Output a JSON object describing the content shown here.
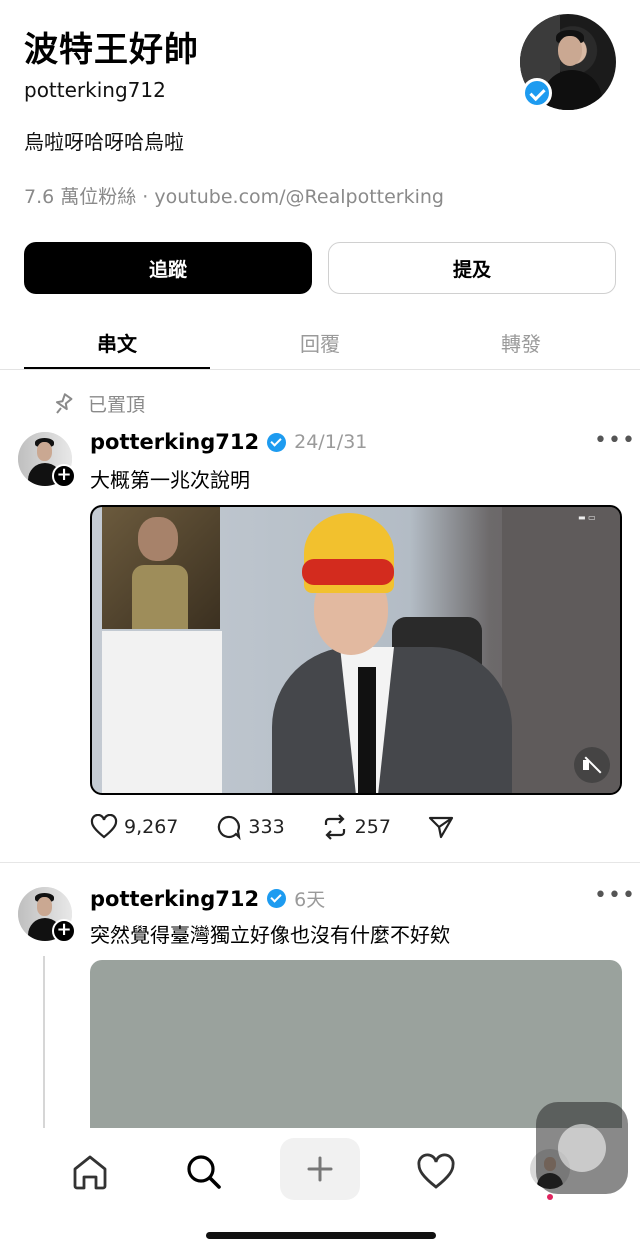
{
  "profile": {
    "display_name": "波特王好帥",
    "username": "potterking712",
    "bio": "烏啦呀哈呀哈烏啦",
    "meta": "7.6 萬位粉絲 · youtube.com/@Realpotterking",
    "verified": true
  },
  "buttons": {
    "follow_label": "追蹤",
    "mention_label": "提及"
  },
  "tabs": [
    {
      "label": "串文",
      "active": true
    },
    {
      "label": "回覆",
      "active": false
    },
    {
      "label": "轉發",
      "active": false
    }
  ],
  "pinned_label": "已置頂",
  "posts": [
    {
      "username": "potterking712",
      "time": "24/1/31",
      "text": "大概第一兆次說明",
      "likes": "9,267",
      "replies": "333",
      "reposts": "257",
      "has_video": true,
      "muted": true
    },
    {
      "username": "potterking712",
      "time": "6天",
      "text": "突然覺得臺灣獨立好像也沒有什麼不好欸"
    }
  ],
  "icons": {
    "pin": "pin-icon",
    "more": "more-dots-icon",
    "like": "heart-icon",
    "reply": "comment-icon",
    "repost": "repost-icon",
    "share": "send-icon",
    "home": "home-icon",
    "search": "search-icon",
    "create": "plus-icon",
    "activity": "heart-icon",
    "profile": "avatar"
  },
  "colors": {
    "accent_verified": "#1d9bf0",
    "primary_button": "#000000",
    "secondary_text": "#8a8a8a"
  }
}
